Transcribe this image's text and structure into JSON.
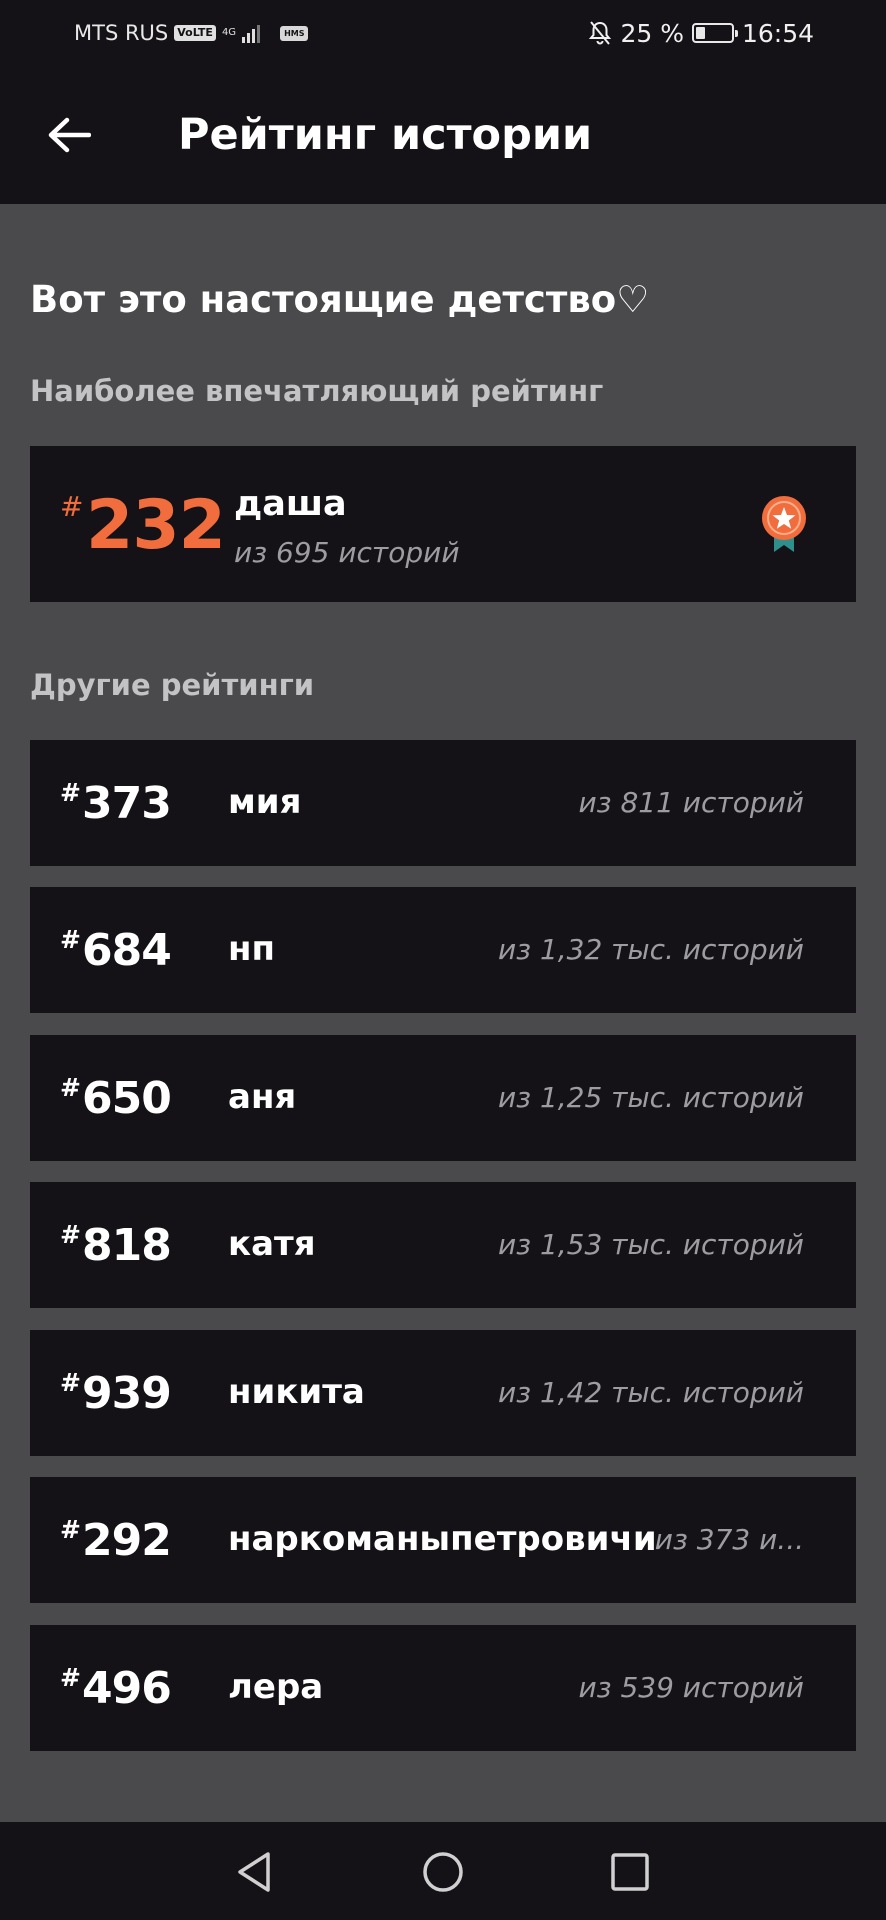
{
  "status_bar": {
    "carrier": "MTS RUS",
    "volte": "VoLTE",
    "network": "4G",
    "hms": "HMS",
    "battery_percent": "25 %",
    "battery_level": 0.25,
    "time": "16:54"
  },
  "app_bar": {
    "title": "Рейтинг истории"
  },
  "story": {
    "title": "Вот это настоящие детство♡"
  },
  "top_section": {
    "label": "Наиболее впечатляющий рейтинг",
    "hash": "#",
    "rank": "232",
    "name": "даша",
    "subtitle": "из 695 историй"
  },
  "other_section": {
    "label": "Другие рейтинги",
    "items": [
      {
        "hash": "#",
        "rank": "373",
        "name": "мия",
        "subtitle": "из 811 историй"
      },
      {
        "hash": "#",
        "rank": "684",
        "name": "нп",
        "subtitle": "из 1,32 тыс. историй"
      },
      {
        "hash": "#",
        "rank": "650",
        "name": "аня",
        "subtitle": "из 1,25 тыс. историй"
      },
      {
        "hash": "#",
        "rank": "818",
        "name": "катя",
        "subtitle": "из 1,53 тыс. историй"
      },
      {
        "hash": "#",
        "rank": "939",
        "name": "никита",
        "subtitle": "из 1,42 тыс. историй"
      },
      {
        "hash": "#",
        "rank": "292",
        "name": "наркоманыпетровичи",
        "subtitle": "из 373 и..."
      },
      {
        "hash": "#",
        "rank": "496",
        "name": "лера",
        "subtitle": "из 539 историй"
      }
    ]
  },
  "colors": {
    "accent": "#f26d3d",
    "card_bg": "#141216",
    "page_bg": "#4a494c",
    "muted_text": "#9d9ca0",
    "medal_ribbon": "#2f8f8c"
  }
}
